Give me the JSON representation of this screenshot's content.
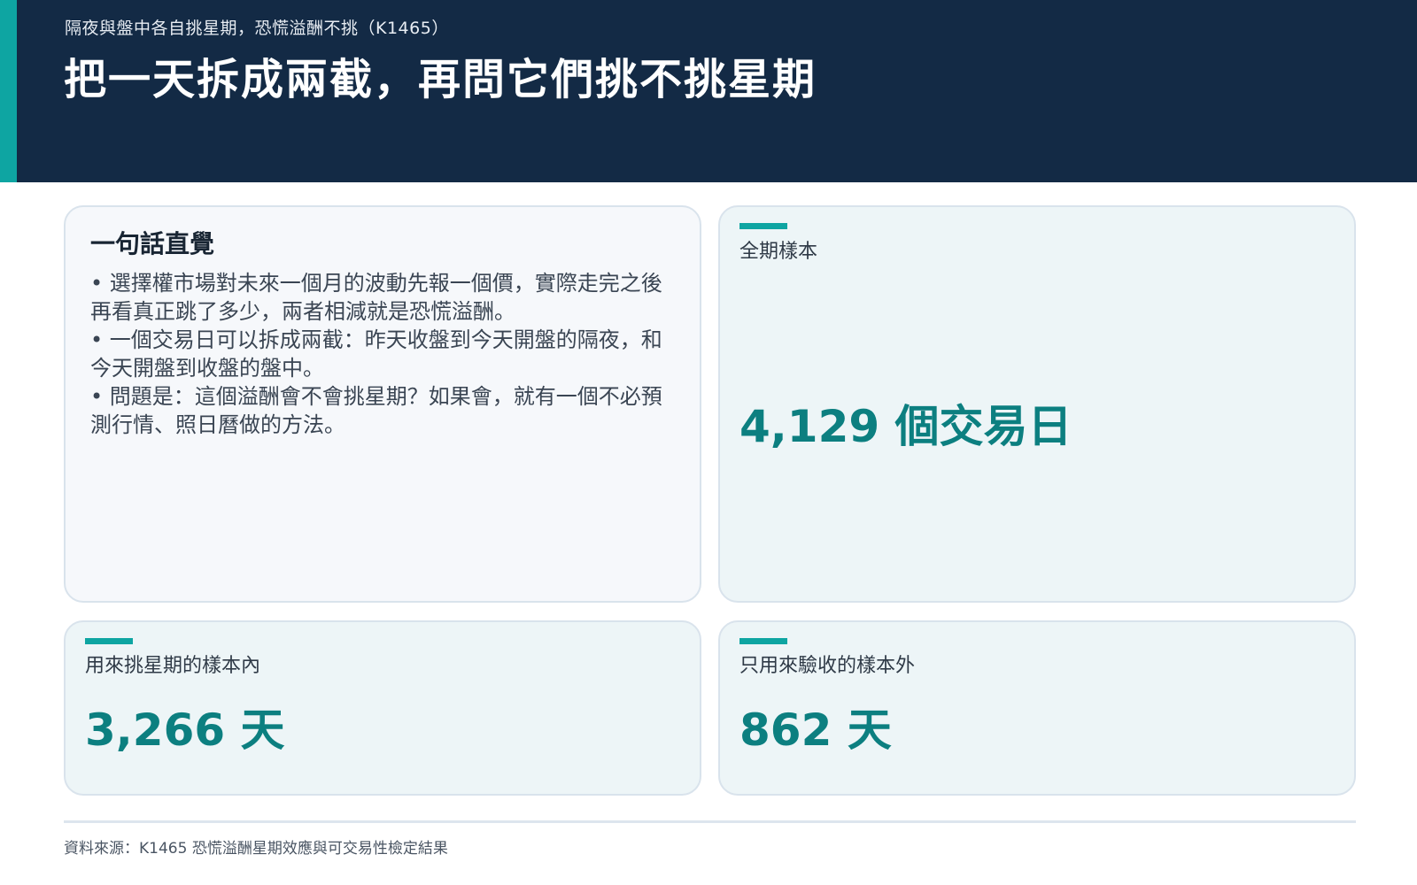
{
  "header": {
    "eyebrow": "隔夜與盤中各自挑星期，恐慌溢酬不挑（K1465）",
    "title": "把一天拆成兩截，再問它們挑不挑星期"
  },
  "intro": {
    "title": "一句話直覺",
    "bullets": [
      "選擇權市場對未來一個月的波動先報一個價，實際走完之後再看真正跳了多少，兩者相減就是恐慌溢酬。",
      "一個交易日可以拆成兩截：昨天收盤到今天開盤的隔夜，和今天開盤到收盤的盤中。",
      "問題是：這個溢酬會不會挑星期？如果會，就有一個不必預測行情、照日曆做的方法。"
    ]
  },
  "stats": {
    "total": {
      "label": "全期樣本",
      "value": "4,129 個交易日"
    },
    "in_sample": {
      "label": "用來挑星期的樣本內",
      "value": "3,266 天"
    },
    "out_sample": {
      "label": "只用來驗收的樣本外",
      "value": "862 天"
    }
  },
  "footer": {
    "source": "資料來源：K1465 恐慌溢酬星期效應與可交易性檢定結果"
  },
  "colors": {
    "header_bg": "#132a45",
    "accent": "#0ea5a2",
    "value_text": "#0c7f80"
  }
}
